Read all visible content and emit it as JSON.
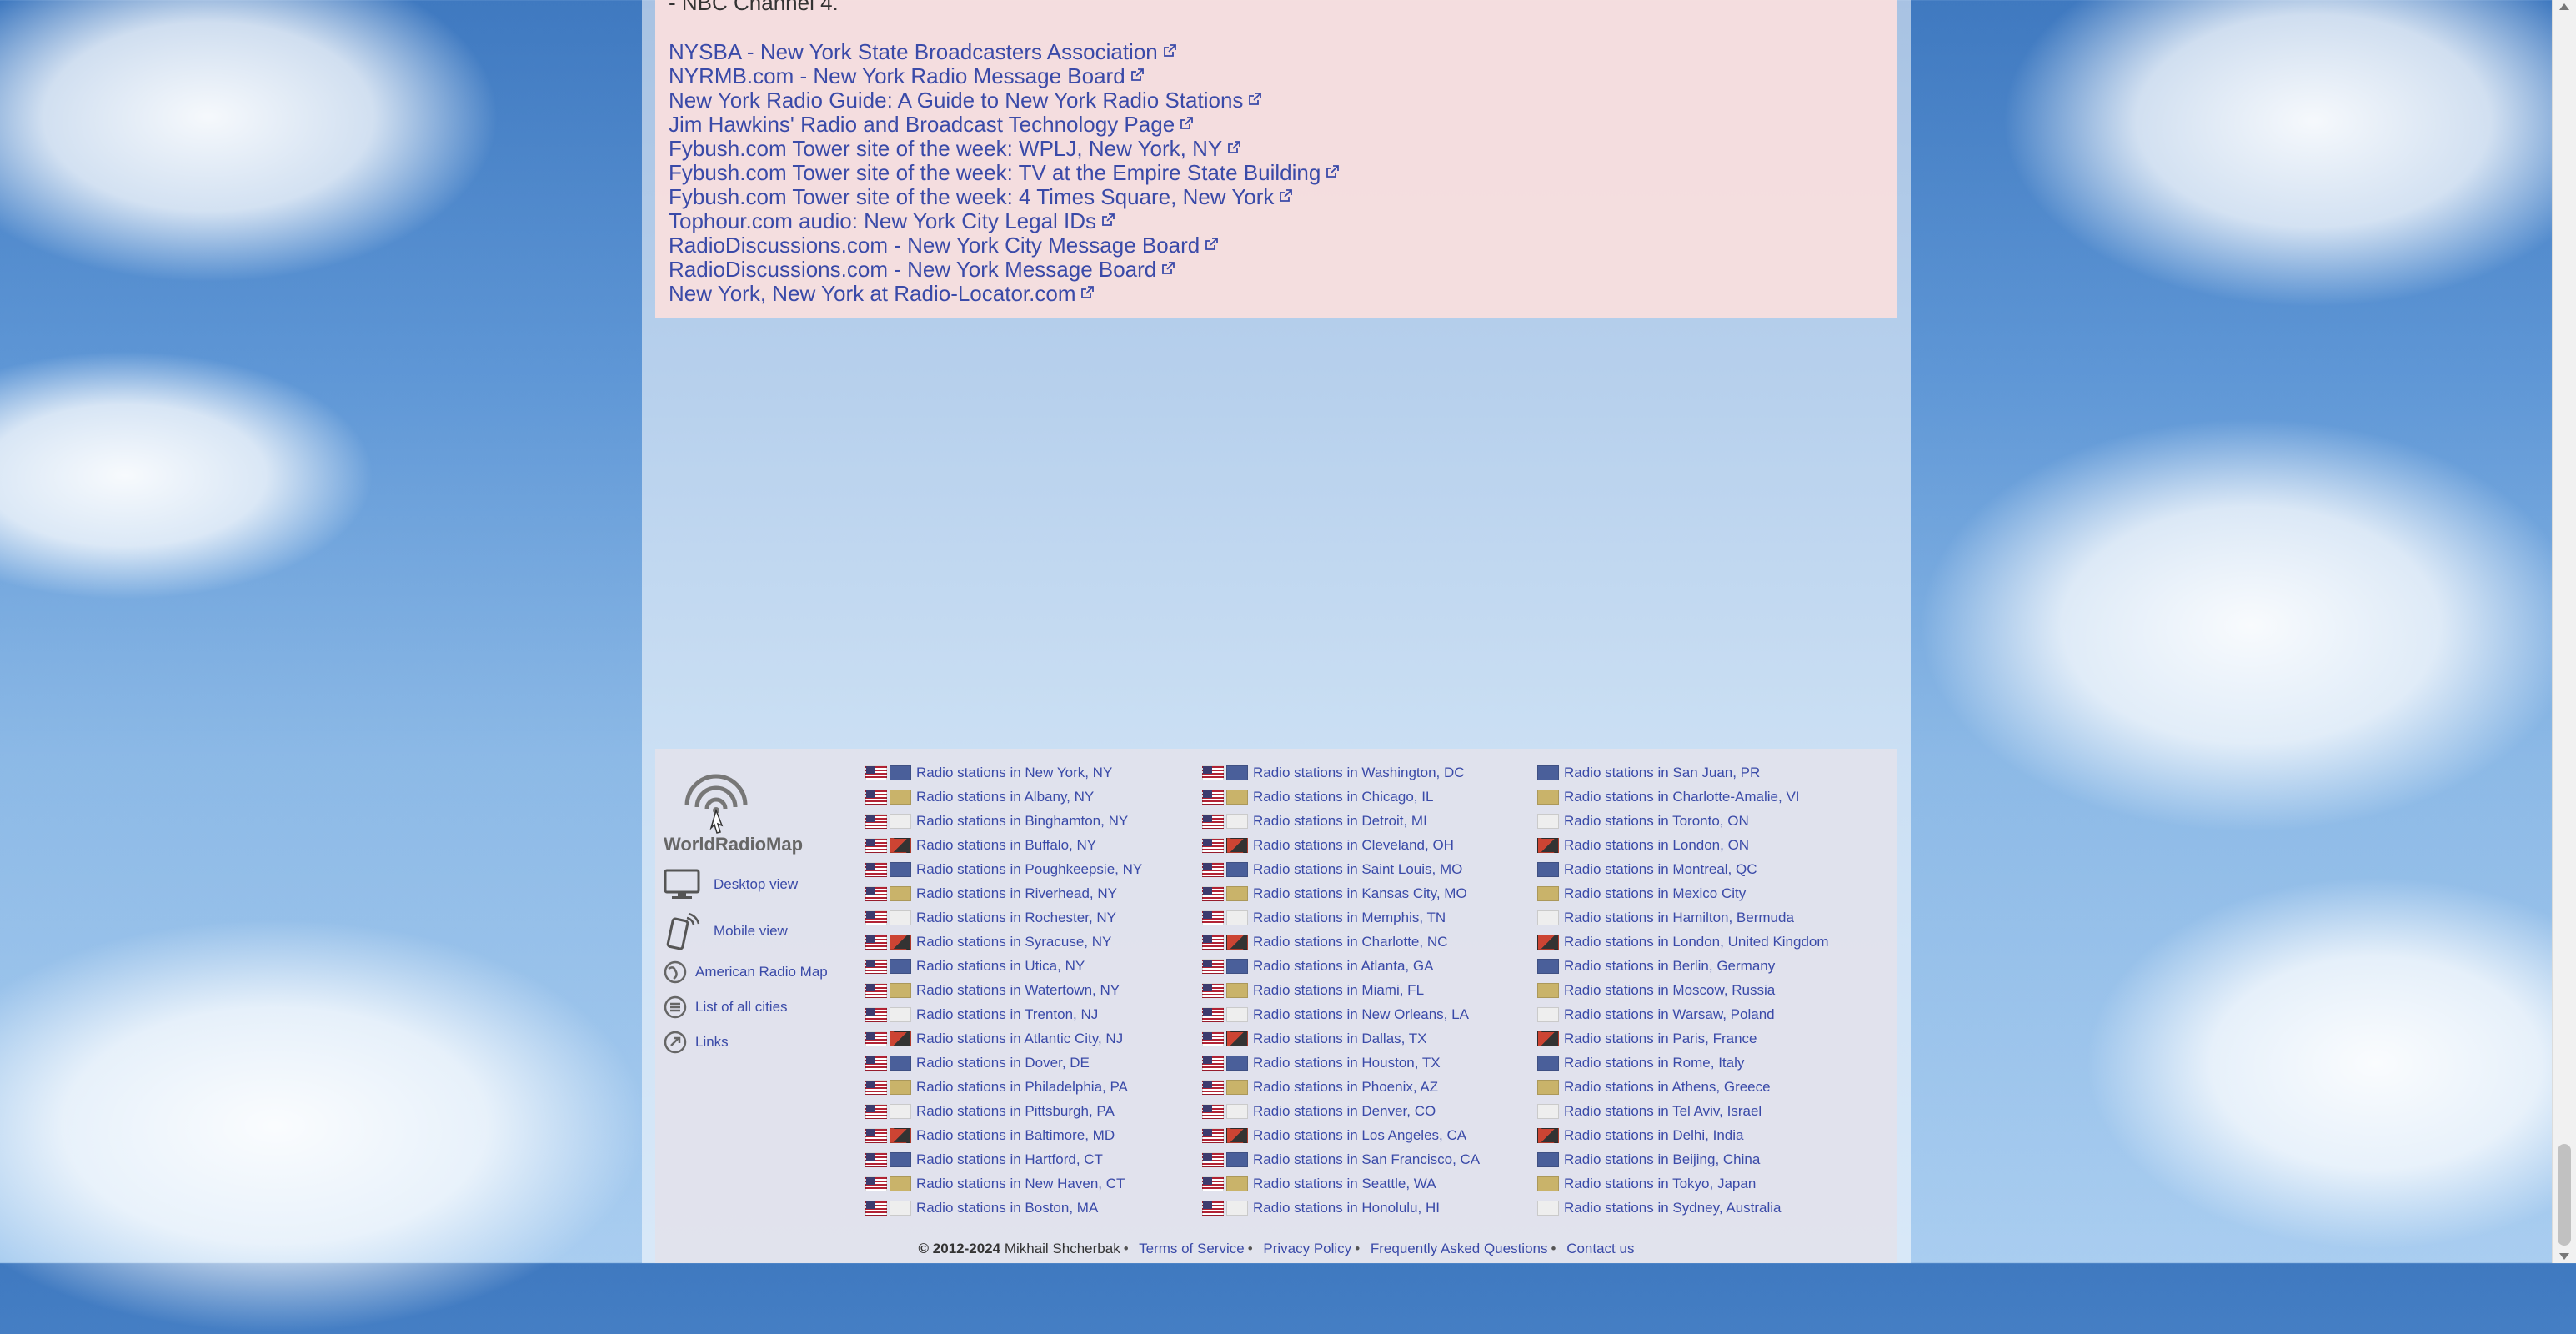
{
  "prev_line": "- NBC Channel 4.",
  "links": [
    "NYSBA - New York State Broadcasters Association",
    "NYRMB.com - New York Radio Message Board",
    "New York Radio Guide: A Guide to New York Radio Stations",
    "Jim Hawkins' Radio and Broadcast Technology Page",
    "Fybush.com Tower site of the week: WPLJ, New York, NY",
    "Fybush.com Tower site of the week: TV at the Empire State Building",
    "Fybush.com Tower site of the week: 4 Times Square, New York",
    "Tophour.com audio: New York City Legal IDs",
    "RadioDiscussions.com - New York City Message Board",
    "RadioDiscussions.com - New York Message Board",
    "New York, New York at Radio-Locator.com"
  ],
  "footer": {
    "logo_text": "WorldRadioMap",
    "nav": {
      "desktop": "Desktop view",
      "mobile": "Mobile view",
      "american": "American Radio Map",
      "cities": "List of all cities",
      "links": "Links"
    },
    "col1": [
      "Radio stations in New York, NY",
      "Radio stations in Albany, NY",
      "Radio stations in Binghamton, NY",
      "Radio stations in Buffalo, NY",
      "Radio stations in Poughkeepsie, NY",
      "Radio stations in Riverhead, NY",
      "Radio stations in Rochester, NY",
      "Radio stations in Syracuse, NY",
      "Radio stations in Utica, NY",
      "Radio stations in Watertown, NY",
      "Radio stations in Trenton, NJ",
      "Radio stations in Atlantic City, NJ",
      "Radio stations in Dover, DE",
      "Radio stations in Philadelphia, PA",
      "Radio stations in Pittsburgh, PA",
      "Radio stations in Baltimore, MD",
      "Radio stations in Hartford, CT",
      "Radio stations in New Haven, CT",
      "Radio stations in Boston, MA"
    ],
    "col2": [
      "Radio stations in Washington, DC",
      "Radio stations in Chicago, IL",
      "Radio stations in Detroit, MI",
      "Radio stations in Cleveland, OH",
      "Radio stations in Saint Louis, MO",
      "Radio stations in Kansas City, MO",
      "Radio stations in Memphis, TN",
      "Radio stations in Charlotte, NC",
      "Radio stations in Atlanta, GA",
      "Radio stations in Miami, FL",
      "Radio stations in New Orleans, LA",
      "Radio stations in Dallas, TX",
      "Radio stations in Houston, TX",
      "Radio stations in Phoenix, AZ",
      "Radio stations in Denver, CO",
      "Radio stations in Los Angeles, CA",
      "Radio stations in San Francisco, CA",
      "Radio stations in Seattle, WA",
      "Radio stations in Honolulu, HI"
    ],
    "col3": [
      "Radio stations in San Juan, PR",
      "Radio stations in Charlotte-Amalie, VI",
      "Radio stations in Toronto, ON",
      "Radio stations in London, ON",
      "Radio stations in Montreal, QC",
      "Radio stations in Mexico City",
      "Radio stations in Hamilton, Bermuda",
      "Radio stations in London, United Kingdom",
      "Radio stations in Berlin, Germany",
      "Radio stations in Moscow, Russia",
      "Radio stations in Warsaw, Poland",
      "Radio stations in Paris, France",
      "Radio stations in Rome, Italy",
      "Radio stations in Athens, Greece",
      "Radio stations in Tel Aviv, Israel",
      "Radio stations in Delhi, India",
      "Radio stations in Beijing, China",
      "Radio stations in Tokyo, Japan",
      "Radio stations in Sydney, Australia"
    ],
    "copyright_year": "© 2012-2024",
    "author": "Mikhail Shcherbak",
    "terms": "Terms of Service",
    "privacy": "Privacy Policy",
    "faq": "Frequently Asked Questions",
    "contact": "Contact us"
  },
  "colors": {
    "link": "#3a4aa8",
    "panel": "#f8dede",
    "footer": "#e2e2ec"
  }
}
